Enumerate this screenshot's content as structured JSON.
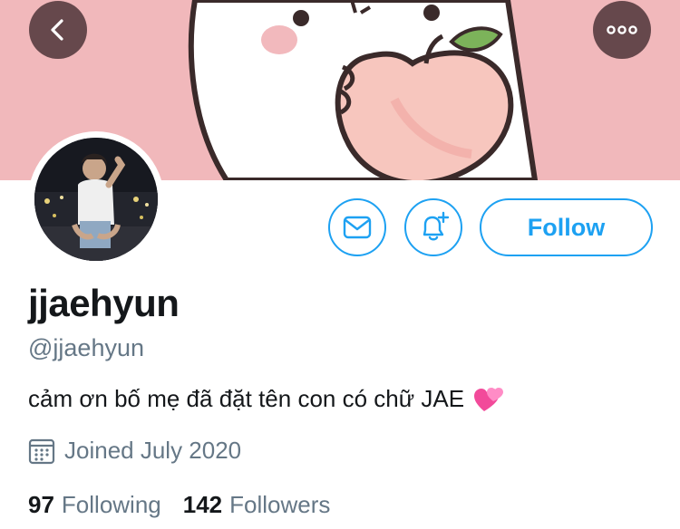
{
  "header": {
    "back_icon": "chevron-left-icon",
    "more_icon": "ellipsis-icon",
    "banner_colors": {
      "background": "#f1b8bb",
      "peach": "#f7c6be",
      "outline": "#3a2a2a",
      "leaf": "#7cb35a"
    }
  },
  "profile": {
    "display_name": "jjaehyun",
    "handle": "@jjaehyun",
    "bio": "cảm ơn bố mẹ đã đặt tên con có chữ JAE",
    "bio_emoji": "heart-pair-emoji",
    "joined": "Joined July 2020"
  },
  "actions": {
    "message_icon": "mail-icon",
    "notify_icon": "bell-add-icon",
    "follow_label": "Follow"
  },
  "stats": {
    "following_count": "97",
    "following_label": "Following",
    "followers_count": "142",
    "followers_label": "Followers"
  },
  "colors": {
    "accent": "#1da1f2",
    "muted": "#657786",
    "text": "#14171a"
  }
}
